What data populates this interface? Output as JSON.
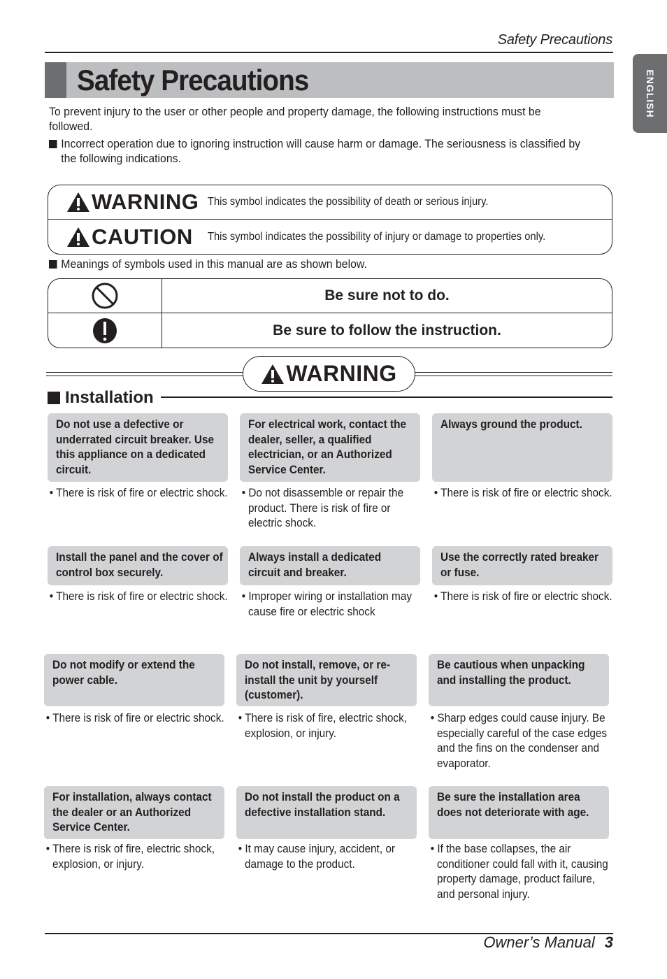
{
  "running_head": "Safety Precautions",
  "language_tab": "ENGLISH",
  "page_title": "Safety Precautions",
  "intro": {
    "paragraph": "To prevent injury to the user or other people and property damage, the following instructions must be followed.",
    "bullet": "Incorrect operation due to ignoring instruction will cause harm or damage. The seriousness is classified by the following indications."
  },
  "signal_words": [
    {
      "icon": "warning-triangle-icon",
      "label": "WARNING",
      "description": "This symbol indicates the possibility of death or serious injury."
    },
    {
      "icon": "warning-triangle-icon",
      "label": "CAUTION",
      "description": "This symbol indicates the possibility of injury or damage to properties only."
    }
  ],
  "symbols_note": "Meanings of symbols used in this manual are as shown below.",
  "symbols": [
    {
      "icon": "prohibition-icon",
      "meaning": "Be sure not to do."
    },
    {
      "icon": "exclamation-icon",
      "meaning": "Be sure to follow the instruction."
    }
  ],
  "warning_banner": "WARNING",
  "section": {
    "title": "Installation",
    "items": [
      {
        "heading": "Do not use a defective or underrated circuit breaker. Use this appliance on a dedicated circuit.",
        "note": "There is risk of fire or electric shock."
      },
      {
        "heading": "For electrical work, contact the dealer, seller, a qualified electrician, or an Authorized Service Center.",
        "note": "Do not disassemble or repair the product. There is risk of fire or electric shock."
      },
      {
        "heading": "Always ground the product.",
        "note": "There is risk of fire or electric shock."
      },
      {
        "heading": "Install the panel and the cover of control box securely.",
        "note": "There is risk of fire or electric shock."
      },
      {
        "heading": "Always install a dedicated circuit and breaker.",
        "note": "Improper wiring or installation may cause fire or electric shock"
      },
      {
        "heading": "Use the correctly rated breaker or fuse.",
        "note": "There is risk of fire or electric shock."
      },
      {
        "heading": "Do not modify or extend the power cable.",
        "note": "There is risk of fire or electric shock."
      },
      {
        "heading": "Do not install, remove, or re-install the unit by yourself (customer).",
        "note": "There is risk of fire, electric shock, explosion, or injury."
      },
      {
        "heading": "Be cautious when unpacking and installing  the product.",
        "note": "Sharp edges could cause injury. Be especially careful of the case edges and the fins on the condenser and evaporator."
      },
      {
        "heading": "For installation, always contact the dealer or an Authorized Service Center.",
        "note": "There is risk of fire, electric shock, explosion, or injury."
      },
      {
        "heading": "Do not install the product on a defective installation stand.",
        "note": "It may cause injury, accident, or damage to the product."
      },
      {
        "heading": "Be sure the installation area does not deteriorate with age.",
        "note": "If the base collapses, the air conditioner could fall with it, causing property damage, product failure, and personal injury."
      }
    ]
  },
  "footer": {
    "label": "Owner’s Manual",
    "page_number": "3"
  },
  "colors": {
    "text": "#231f20",
    "title_bar": "#bcbec0",
    "title_accent": "#6d6e70",
    "card": "#d1d3d4",
    "tab": "#6d6e70"
  }
}
